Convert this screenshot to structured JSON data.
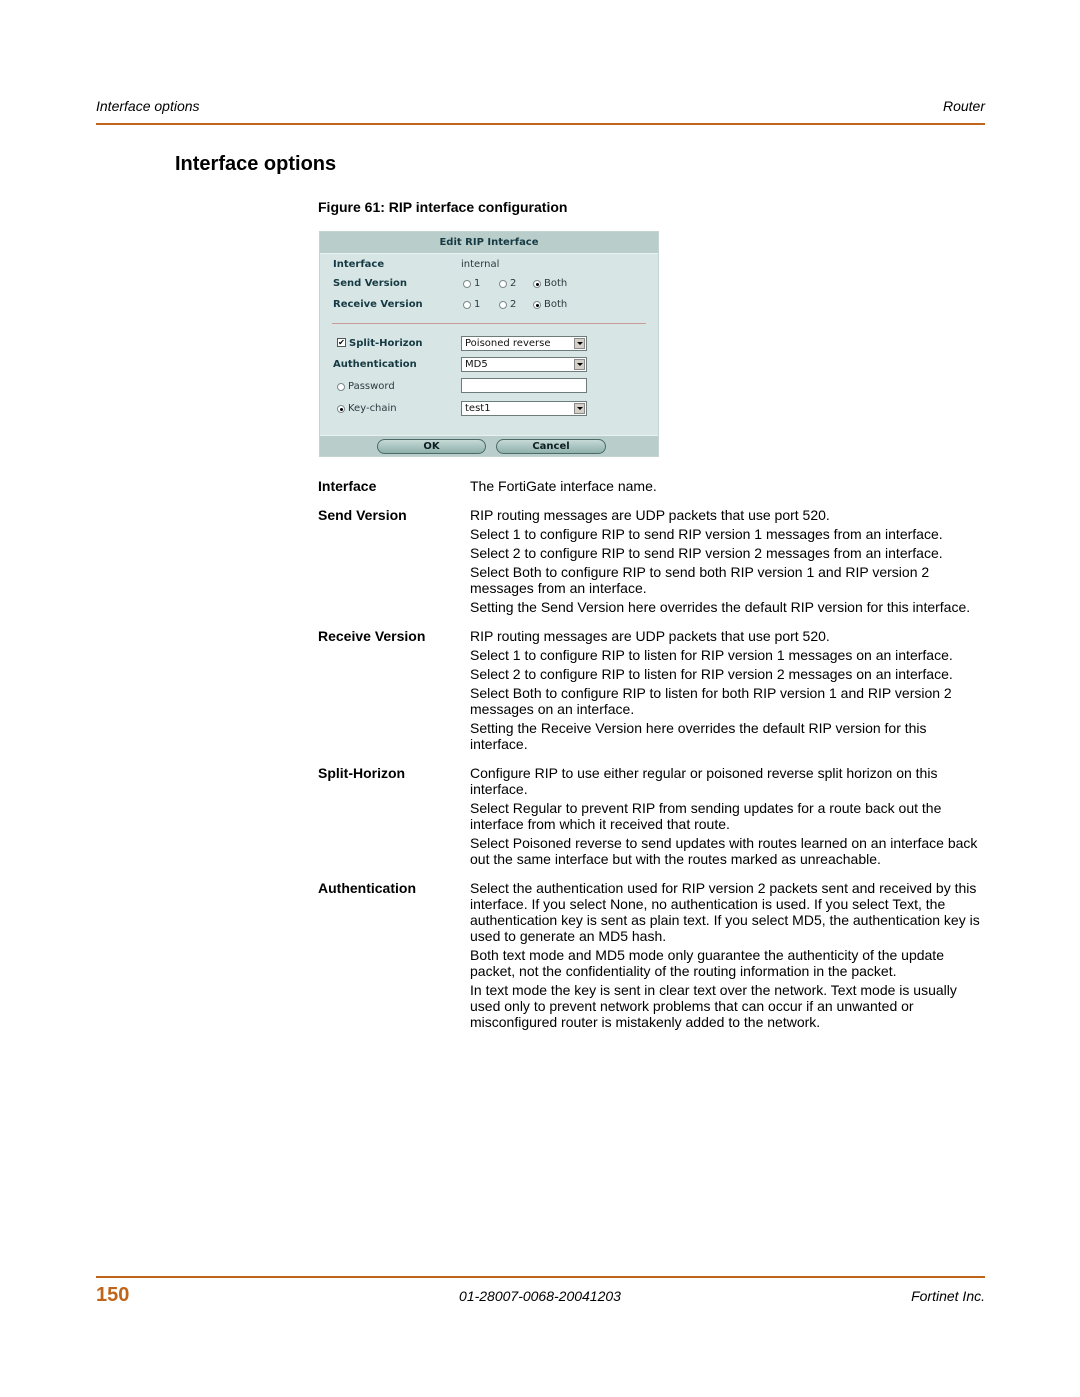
{
  "header": {
    "left": "Interface options",
    "right": "Router",
    "rule_color": "#c0641a"
  },
  "section_title": "Interface options",
  "figure_caption": "Figure 61: RIP interface configuration",
  "dialog": {
    "title": "Edit RIP Interface",
    "interface_label": "Interface",
    "interface_value": "internal",
    "send_version": {
      "label": "Send Version",
      "options": [
        "1",
        "2",
        "Both"
      ],
      "selected": "Both"
    },
    "receive_version": {
      "label": "Receive Version",
      "options": [
        "1",
        "2",
        "Both"
      ],
      "selected": "Both"
    },
    "split_horizon": {
      "label": "Split-Horizon",
      "checked": true,
      "checkmark": "✔",
      "selected": "Poisoned reverse"
    },
    "authentication": {
      "label": "Authentication",
      "selected": "MD5"
    },
    "password": {
      "label": "Password",
      "value": "",
      "selected": false
    },
    "key_chain": {
      "label": "Key-chain",
      "selected_radio": true,
      "value": "test1"
    },
    "ok_label": "OK",
    "cancel_label": "Cancel"
  },
  "descriptions": [
    {
      "term": "Interface",
      "paragraphs": [
        "The FortiGate interface name."
      ]
    },
    {
      "term": "Send Version",
      "paragraphs": [
        "RIP routing messages are UDP packets that use port 520.",
        "Select 1 to configure RIP to send RIP version 1 messages from an interface.",
        "Select 2 to configure RIP to send RIP version 2 messages from an interface.",
        "Select Both to configure RIP to send both RIP version 1 and RIP version 2 messages from an interface.",
        "Setting the Send Version here overrides the default RIP version for this interface."
      ]
    },
    {
      "term": "Receive Version",
      "paragraphs": [
        "RIP routing messages are UDP packets that use port 520.",
        "Select 1 to configure RIP to listen for RIP version 1 messages on an interface.",
        "Select 2 to configure RIP to listen for RIP version 2 messages on an interface.",
        "Select Both to configure RIP to listen for both RIP version 1 and RIP version 2 messages on an interface.",
        "Setting the Receive Version here overrides the default RIP version for this interface."
      ]
    },
    {
      "term": "Split-Horizon",
      "paragraphs": [
        "Configure RIP to use either regular or poisoned reverse split horizon on this interface.",
        "Select Regular to prevent RIP from sending updates for a route back out the interface from which it received that route.",
        "Select Poisoned reverse to send updates with routes learned on an interface back out the same interface but with the routes marked as unreachable."
      ]
    },
    {
      "term": "Authentication",
      "paragraphs": [
        "Select the authentication used for RIP version 2 packets sent and received by this interface. If you select None, no authentication is used. If you select Text, the authentication key is sent as plain text. If you select MD5, the authentication key is used to generate an MD5 hash.",
        "Both text mode and MD5 mode only guarantee the authenticity of the update packet, not the confidentiality of the routing information in the packet.",
        "In text mode the key is sent in clear text over the network. Text mode is usually used only to prevent network problems that can occur if an unwanted or misconfigured router is mistakenly added to the network."
      ]
    }
  ],
  "footer": {
    "page_number": "150",
    "doc_id": "01-28007-0068-20041203",
    "company": "Fortinet Inc."
  }
}
